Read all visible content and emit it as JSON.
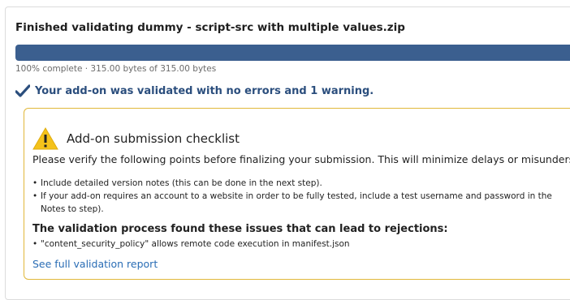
{
  "header": {
    "title": "Finished validating dummy - script-src with multiple values.zip"
  },
  "progress": {
    "percent": 100,
    "label": "100% complete · 315.00 bytes of 315.00 bytes"
  },
  "result": {
    "icon": "check-icon",
    "text": "Your add-on was validated with no errors and 1 warning."
  },
  "checklist": {
    "icon": "warning-icon",
    "title": "Add-on submission checklist",
    "intro": "Please verify the following points before finalizing your submission. This will minimize delays or misunderstan",
    "items": [
      "Include detailed version notes (this can be done in the next step).",
      "If your add-on requires an account to a website in order to be fully tested, include a test username and password in the Notes to step)."
    ],
    "issues_heading": "The validation process found these issues that can lead to rejections:",
    "issues": [
      "\"content_security_policy\" allows remote code execution in manifest.json"
    ],
    "report_link": "See full validation report"
  },
  "colors": {
    "progress_fill": "#3b5f8f",
    "result_text": "#2b4e7d",
    "checklist_border": "#e1b83a",
    "warning_icon": "#f4c21b",
    "link": "#2a6db5"
  }
}
